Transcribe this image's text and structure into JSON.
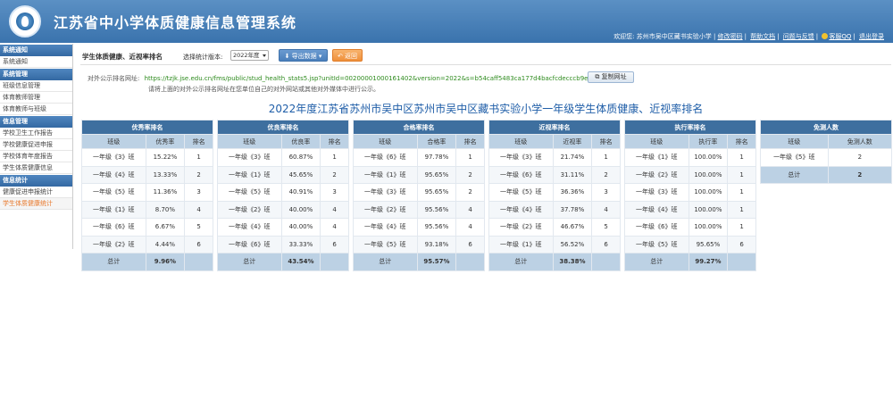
{
  "header": {
    "site_title": "江苏省中小学体质健康信息管理系统",
    "welcome": "欢迎您: 苏州市吴中区藏书实验小学 |",
    "links": [
      "修改密码",
      "帮助文档",
      "问题与反馈"
    ],
    "qq_label": "客服QQ",
    "logout": "退出登录"
  },
  "sidebar": {
    "groups": [
      {
        "title": "系统通知",
        "items": [
          "系统通知"
        ]
      },
      {
        "title": "系统管理",
        "items": [
          "班级信息管理",
          "体育教师管理",
          "体育教师与班级"
        ]
      },
      {
        "title": "信息管理",
        "items": [
          "学校卫生工作报告",
          "学校健康促进申报",
          "学校体育年度报告",
          "学生体质健康信息"
        ]
      },
      {
        "title": "信息统计",
        "items": [
          "健康促进申报统计",
          "学生体质健康统计"
        ]
      }
    ],
    "active_item": "学生体质健康统计"
  },
  "toolbar": {
    "page_label": "学生体质健康、近视率排名",
    "version_label": "选择统计版本:",
    "version_value": "2022年度",
    "export_label": "导出数据",
    "back_label": "返回"
  },
  "share": {
    "label": "对外公示排名网址:",
    "url": "https://tzjk.jse.edu.cn/fms/public/stud_health_stats5.jsp?unitId=00200001000161402&version=2022&s=b54caff5483ca177d4bacfcdecccb9ea",
    "copy_label": "复制网址",
    "hint": "请将上面的对外公示排名网址在您单位自己的对外网站或其他对外媒体中进行公示。"
  },
  "report_title": "2022年度江苏省苏州市吴中区苏州市吴中区藏书实验小学一年级学生体质健康、近视率排名",
  "tables": [
    {
      "title": "优秀率排名",
      "columns": [
        "班级",
        "优秀率",
        "排名"
      ],
      "rows": [
        [
          "一年级《3》班",
          "15.22%",
          "1"
        ],
        [
          "一年级《4》班",
          "13.33%",
          "2"
        ],
        [
          "一年级《5》班",
          "11.36%",
          "3"
        ],
        [
          "一年级《1》班",
          "8.70%",
          "4"
        ],
        [
          "一年级《6》班",
          "6.67%",
          "5"
        ],
        [
          "一年级《2》班",
          "4.44%",
          "6"
        ]
      ],
      "total_label": "总计",
      "total_value": "9.96%"
    },
    {
      "title": "优良率排名",
      "columns": [
        "班级",
        "优良率",
        "排名"
      ],
      "rows": [
        [
          "一年级《3》班",
          "60.87%",
          "1"
        ],
        [
          "一年级《1》班",
          "45.65%",
          "2"
        ],
        [
          "一年级《5》班",
          "40.91%",
          "3"
        ],
        [
          "一年级《2》班",
          "40.00%",
          "4"
        ],
        [
          "一年级《4》班",
          "40.00%",
          "4"
        ],
        [
          "一年级《6》班",
          "33.33%",
          "6"
        ]
      ],
      "total_label": "总计",
      "total_value": "43.54%"
    },
    {
      "title": "合格率排名",
      "columns": [
        "班级",
        "合格率",
        "排名"
      ],
      "rows": [
        [
          "一年级《6》班",
          "97.78%",
          "1"
        ],
        [
          "一年级《1》班",
          "95.65%",
          "2"
        ],
        [
          "一年级《3》班",
          "95.65%",
          "2"
        ],
        [
          "一年级《2》班",
          "95.56%",
          "4"
        ],
        [
          "一年级《4》班",
          "95.56%",
          "4"
        ],
        [
          "一年级《5》班",
          "93.18%",
          "6"
        ]
      ],
      "total_label": "总计",
      "total_value": "95.57%"
    },
    {
      "title": "近视率排名",
      "columns": [
        "班级",
        "近视率",
        "排名"
      ],
      "rows": [
        [
          "一年级《3》班",
          "21.74%",
          "1"
        ],
        [
          "一年级《6》班",
          "31.11%",
          "2"
        ],
        [
          "一年级《5》班",
          "36.36%",
          "3"
        ],
        [
          "一年级《4》班",
          "37.78%",
          "4"
        ],
        [
          "一年级《2》班",
          "46.67%",
          "5"
        ],
        [
          "一年级《1》班",
          "56.52%",
          "6"
        ]
      ],
      "total_label": "总计",
      "total_value": "38.38%"
    },
    {
      "title": "执行率排名",
      "columns": [
        "班级",
        "执行率",
        "排名"
      ],
      "rows": [
        [
          "一年级《1》班",
          "100.00%",
          "1"
        ],
        [
          "一年级《2》班",
          "100.00%",
          "1"
        ],
        [
          "一年级《3》班",
          "100.00%",
          "1"
        ],
        [
          "一年级《4》班",
          "100.00%",
          "1"
        ],
        [
          "一年级《6》班",
          "100.00%",
          "1"
        ],
        [
          "一年级《5》班",
          "95.65%",
          "6"
        ]
      ],
      "total_label": "总计",
      "total_value": "99.27%"
    },
    {
      "title": "免测人数",
      "columns": [
        "班级",
        "免测人数"
      ],
      "rows": [
        [
          "一年级《5》班",
          "2"
        ]
      ],
      "total_label": "总计",
      "total_value": "2"
    }
  ]
}
